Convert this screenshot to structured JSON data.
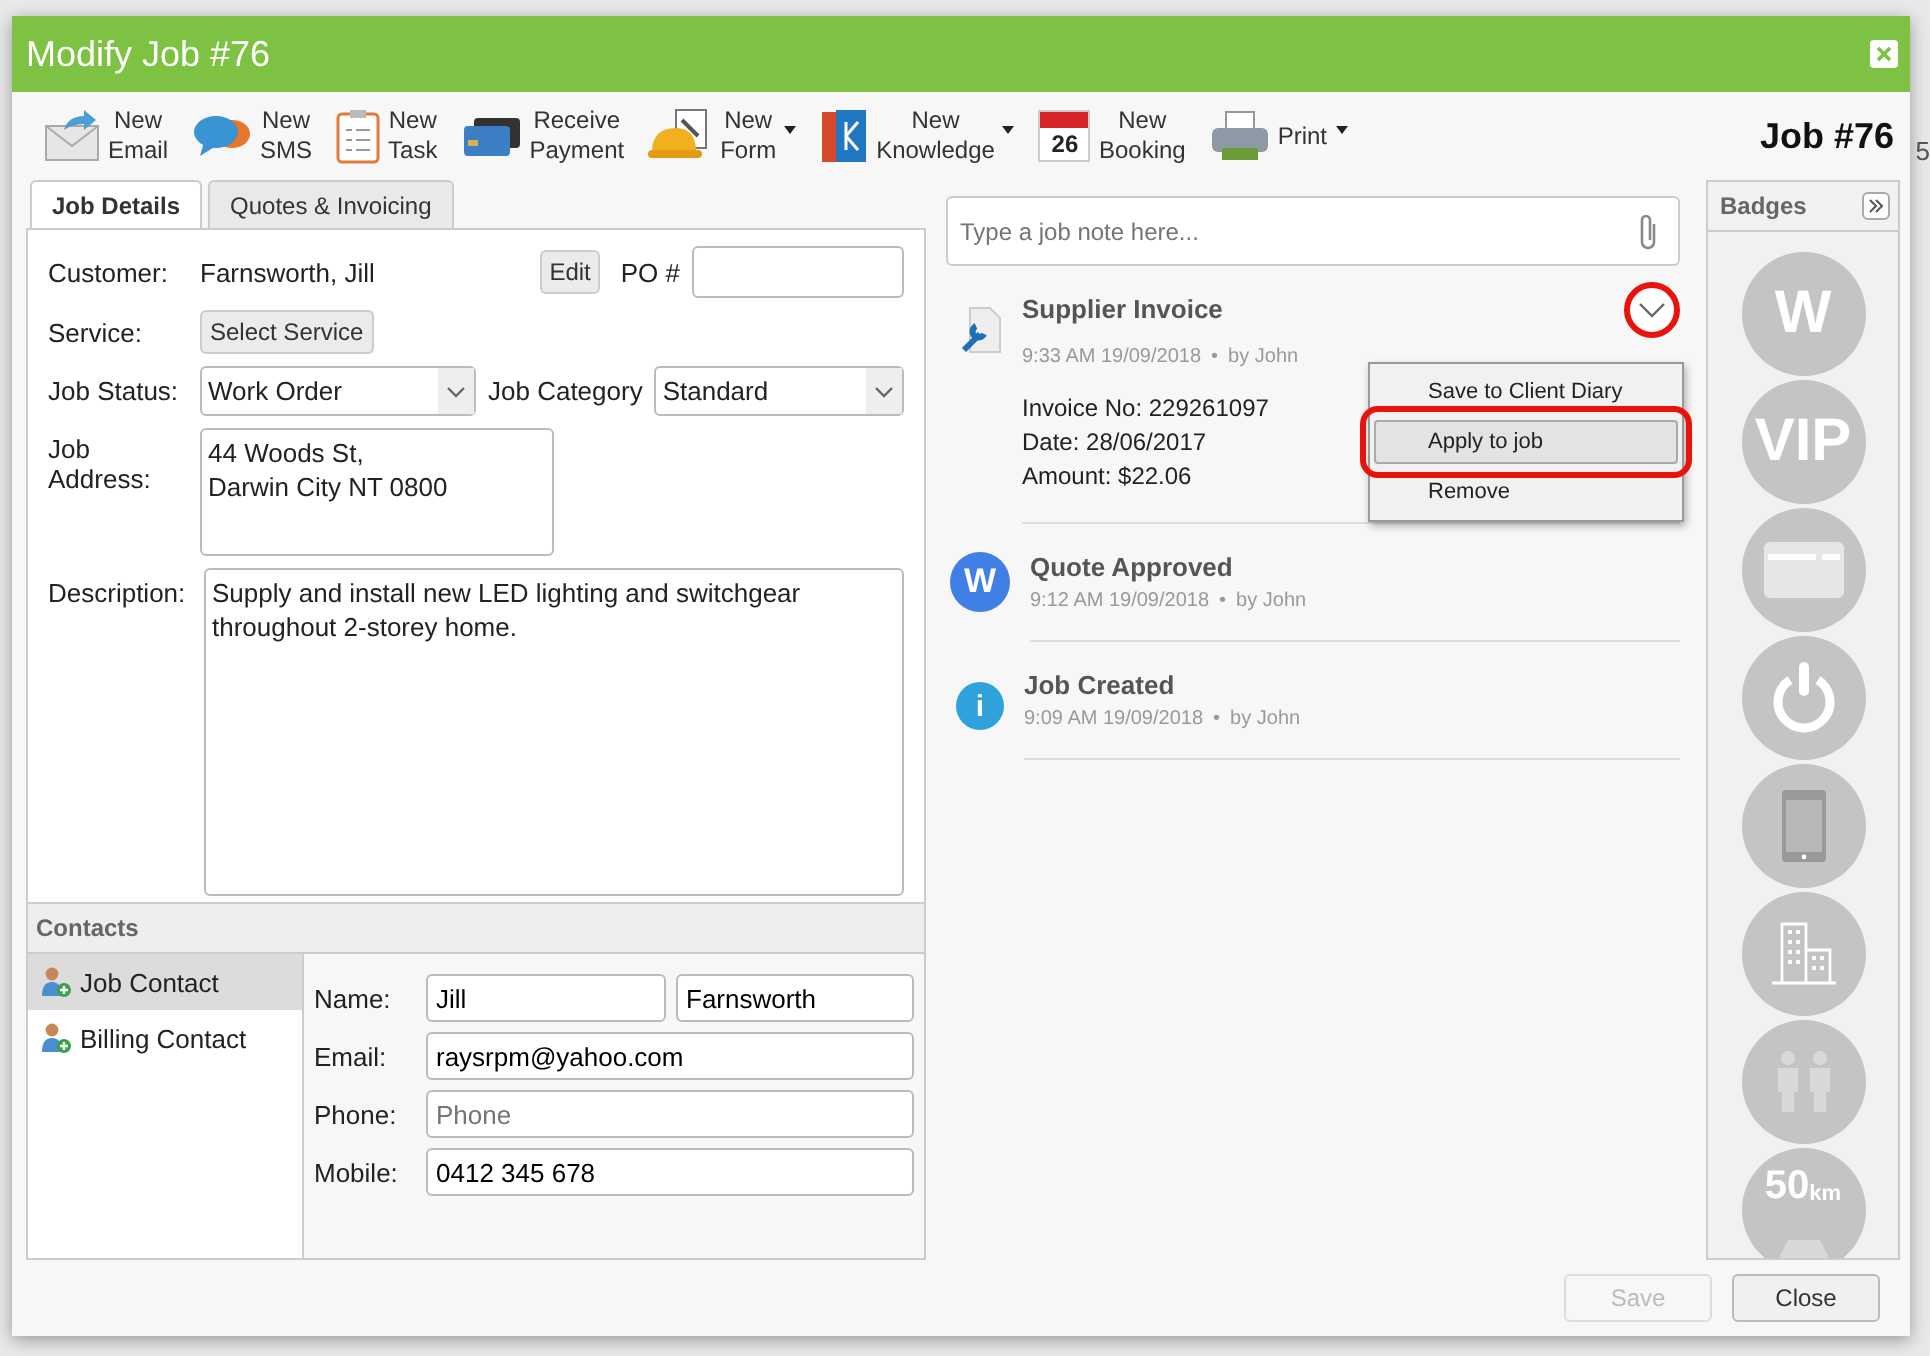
{
  "window": {
    "title": "Modify Job #76"
  },
  "toolbar": [
    {
      "kind": "email",
      "lines": [
        "New",
        "Email"
      ],
      "has_menu": false
    },
    {
      "kind": "sms",
      "lines": [
        "New",
        "SMS"
      ],
      "has_menu": false
    },
    {
      "kind": "task",
      "lines": [
        "New",
        "Task"
      ],
      "has_menu": false
    },
    {
      "kind": "payment",
      "lines": [
        "Receive",
        "Payment"
      ],
      "has_menu": false
    },
    {
      "kind": "form",
      "lines": [
        "New",
        "Form"
      ],
      "has_menu": true
    },
    {
      "kind": "knowledge",
      "lines": [
        "New",
        "Knowledge"
      ],
      "has_menu": true
    },
    {
      "kind": "booking",
      "icon_text": "26",
      "lines": [
        "New",
        "Booking"
      ],
      "has_menu": false
    },
    {
      "kind": "print",
      "lines": [
        "Print"
      ],
      "has_menu": true
    }
  ],
  "job_number": "Job #76",
  "backdrop_text": "5",
  "tabs": [
    {
      "label": "Job Details",
      "selected": true
    },
    {
      "label": "Quotes & Invoicing",
      "selected": false
    }
  ],
  "job_details": {
    "customer_label": "Customer:",
    "customer": "Farnsworth, Jill",
    "edit_button": "Edit",
    "po_label": "PO #",
    "service_label": "Service:",
    "service_button": "Select Service",
    "status_label": "Job Status:",
    "status": "Work Order",
    "category_label": "Job Category",
    "category": "Standard",
    "address_label": "Job Address:",
    "address": "44 Woods St,\nDarwin City NT 0800",
    "description_label": "Description:",
    "description": "Supply and install new LED lighting and switchgear throughout 2-storey home."
  },
  "contacts": {
    "title": "Contacts",
    "items": [
      {
        "label": "Job Contact",
        "selected": true
      },
      {
        "label": "Billing Contact",
        "selected": false
      }
    ],
    "name_label": "Name:",
    "first_name": "Jill",
    "last_name": "Farnsworth",
    "email_label": "Email:",
    "email": "raysrpm@yahoo.com",
    "phone_label": "Phone:",
    "phone_placeholder": "Phone",
    "mobile_label": "Mobile:",
    "mobile": "0412 345 678"
  },
  "note": {
    "placeholder": "Type a job note here..."
  },
  "timeline": [
    {
      "kind": "supplier_invoice",
      "title": "Supplier Invoice",
      "time": "9:33 AM 19/09/2018",
      "separator": "•",
      "author": "by John",
      "menu_open": true,
      "details": [
        "Invoice No: 229261097",
        "Date: 28/06/2017",
        "Amount: $22.06"
      ]
    },
    {
      "kind": "quote",
      "icon_text": "W",
      "title": "Quote Approved",
      "time": "9:12 AM 19/09/2018",
      "separator": "•",
      "author": "by John",
      "menu_open": false
    },
    {
      "kind": "info",
      "icon_text": "i",
      "title": "Job Created",
      "time": "9:09 AM 19/09/2018",
      "separator": "•",
      "author": "by John",
      "menu_open": false
    }
  ],
  "entry_menu": {
    "items": [
      {
        "label": "Save to Client Diary",
        "selected": false
      },
      {
        "label": "Apply to job",
        "selected": true
      },
      {
        "label": "Remove",
        "selected": false
      }
    ]
  },
  "badges": {
    "title": "Badges",
    "items": [
      {
        "kind": "text",
        "label": "W"
      },
      {
        "kind": "text",
        "label": "VIP"
      },
      {
        "kind": "card"
      },
      {
        "kind": "power"
      },
      {
        "kind": "phone"
      },
      {
        "kind": "building"
      },
      {
        "kind": "people"
      },
      {
        "kind": "distance",
        "label": "50",
        "unit": "km"
      }
    ]
  },
  "footer": {
    "buttons": [
      {
        "label": "Save",
        "disabled": true
      },
      {
        "label": "Close",
        "disabled": false
      }
    ]
  }
}
